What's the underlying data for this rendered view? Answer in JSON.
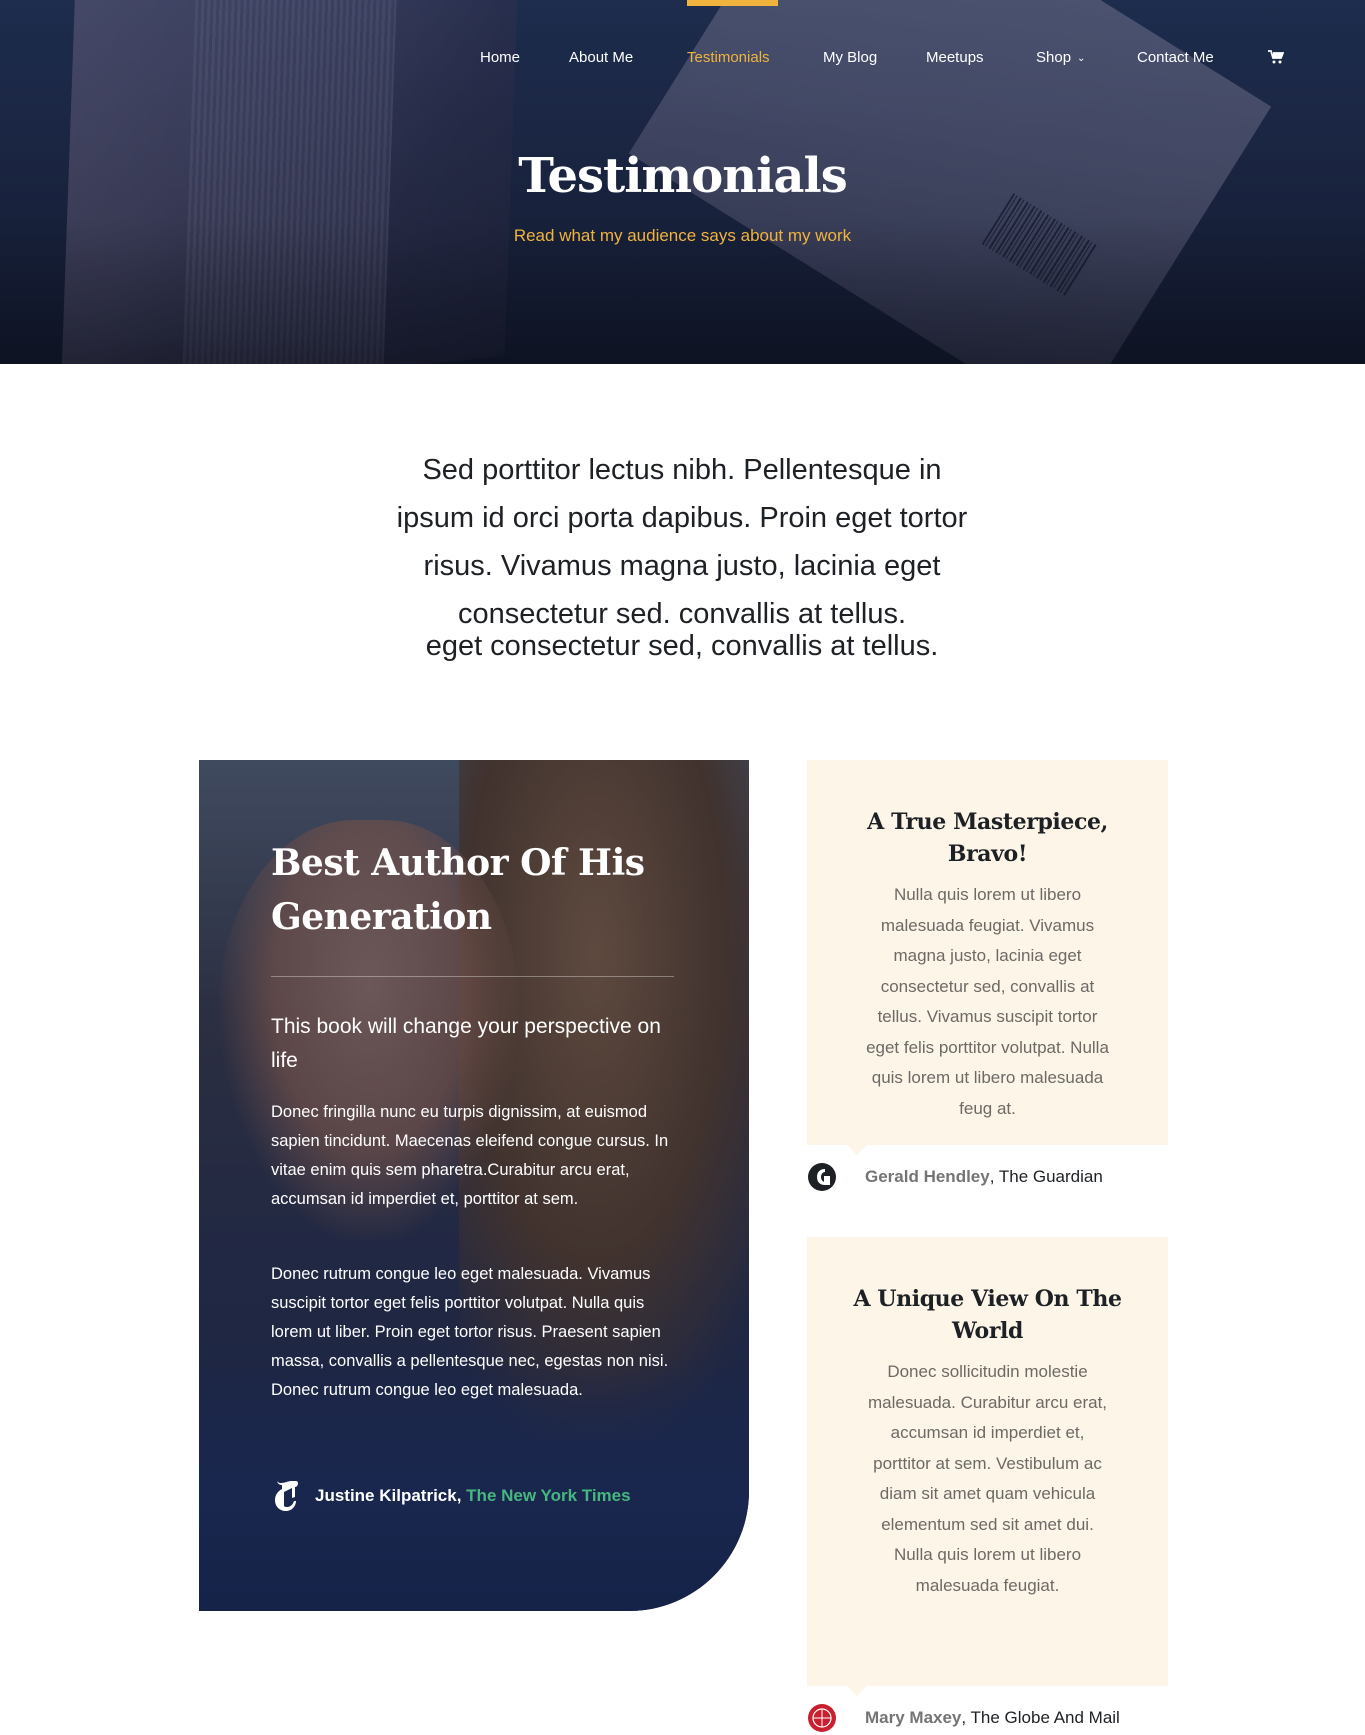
{
  "nav": {
    "items": [
      {
        "label": "Home"
      },
      {
        "label": "About Me"
      },
      {
        "label": "Testimonials"
      },
      {
        "label": "My Blog"
      },
      {
        "label": "Meetups"
      },
      {
        "label": "Shop"
      },
      {
        "label": "Contact Me"
      }
    ],
    "active_index": 2,
    "cart_icon": "cart-icon",
    "dropdown_icon": "chevron-down-icon"
  },
  "hero": {
    "title": "Testimonials",
    "subtitle": "Read what my audience says about my work"
  },
  "intro": {
    "text": "Sed porttitor lectus nibh. Pellentesque in ipsum id orci porta dapibus. Proin eget tortor risus. Vivamus magna justo, lacinia eget consectetur sed. convallis at tellus.",
    "duplicate_line": "eget consectetur sed, convallis at tellus."
  },
  "feature": {
    "title": "Best Author Of His Generation",
    "lead": "This book will change your perspective on life",
    "paragraph_1": "Donec fringilla nunc eu turpis dignissim, at euismod sapien tincidunt. Maecenas eleifend congue cursus. In vitae enim quis sem pharetra.Curabitur arcu erat, accumsan id imperdiet et, porttitor at sem.",
    "paragraph_2": "Donec rutrum congue leo eget malesuada. Vivamus suscipit tortor eget felis porttitor volutpat. Nulla quis lorem ut liber. Proin eget tortor risus. Praesent sapien massa, convallis a pellentesque nec, egestas non nisi. Donec rutrum congue leo eget malesuada.",
    "author_name": "Justine Kilpatrick,",
    "author_publication": "The New York Times",
    "author_logo_icon": "nyt-logo-icon"
  },
  "testimonials": [
    {
      "title": "A True Masterpiece, Bravo!",
      "body": "Nulla quis lorem ut libero malesuada feugiat. Vivamus magna justo, lacinia eget consectetur sed, convallis at tellus. Vivamus suscipit tortor eget felis porttitor volutpat. Nulla quis lorem ut libero malesuada feug at.",
      "author_name": "Gerald Hendley",
      "author_publication": ", The Guardian",
      "logo_icon": "guardian-logo-icon"
    },
    {
      "title": "A Unique View On The World",
      "body": "Donec sollicitudin molestie malesuada. Curabitur arcu erat, accumsan id imperdiet et, porttitor at sem. Vestibulum ac diam sit amet quam vehicula elementum sed sit amet dui. Nulla quis lorem ut libero malesuada feugiat.",
      "author_name": "Mary Maxey",
      "author_publication": ", The Globe And Mail",
      "logo_icon": "globe-and-mail-logo-icon"
    }
  ],
  "colors": {
    "accent": "#f0b33e",
    "card_background": "#fcf5e8",
    "publication_green": "#47b77f",
    "hero_navy": "#1f2c4b"
  }
}
